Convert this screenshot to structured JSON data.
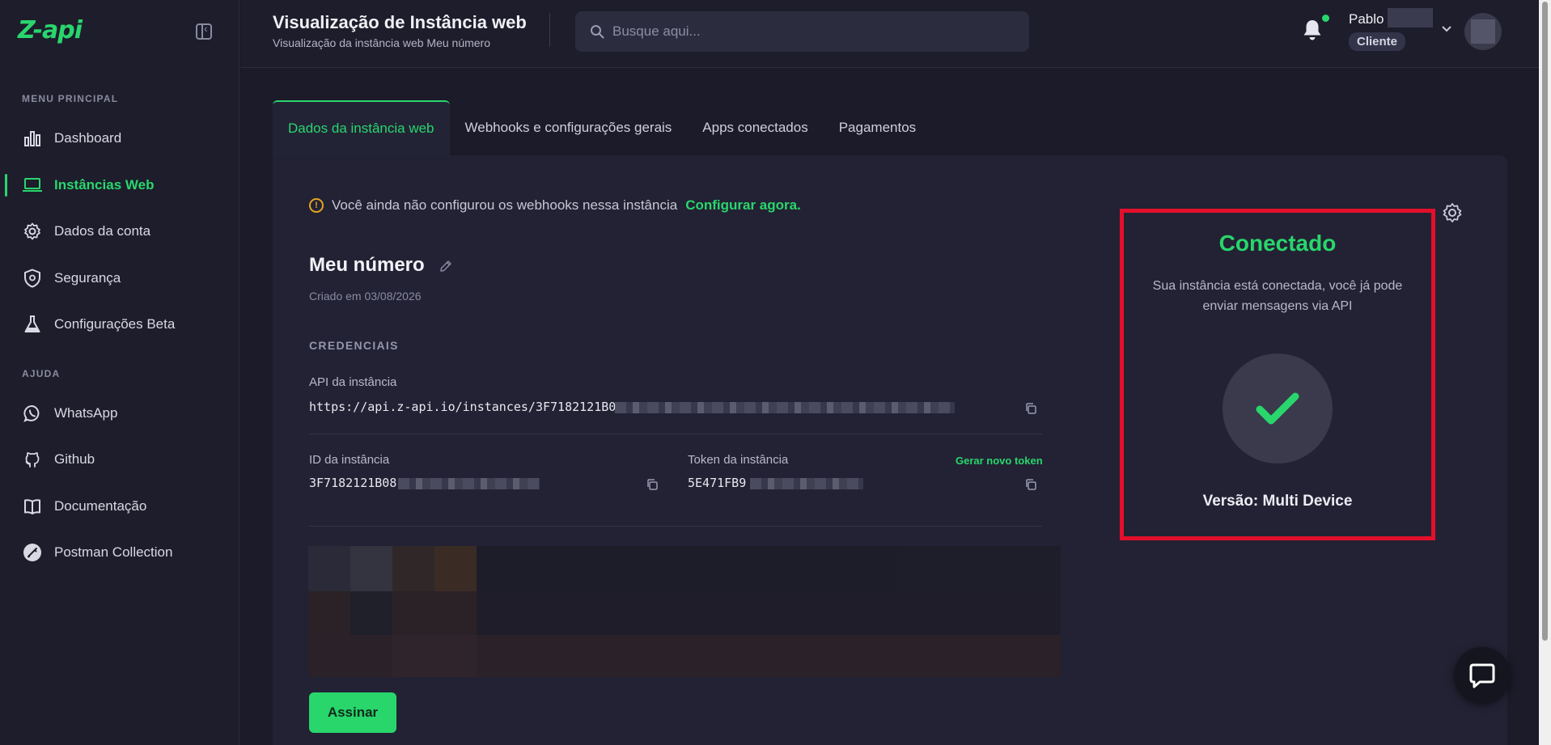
{
  "brand": {
    "logo_text": "Z-api"
  },
  "sidebar": {
    "main_section_title": "MENU PRINCIPAL",
    "help_section_title": "AJUDA",
    "main_items": [
      {
        "label": "Dashboard",
        "icon": "bar-chart-icon"
      },
      {
        "label": "Instâncias Web",
        "icon": "laptop-icon",
        "active": true
      },
      {
        "label": "Dados da conta",
        "icon": "gear-icon"
      },
      {
        "label": "Segurança",
        "icon": "shield-icon"
      },
      {
        "label": "Configurações Beta",
        "icon": "flask-icon"
      }
    ],
    "help_items": [
      {
        "label": "WhatsApp",
        "icon": "whatsapp-icon"
      },
      {
        "label": "Github",
        "icon": "github-icon"
      },
      {
        "label": "Documentação",
        "icon": "book-icon"
      },
      {
        "label": "Postman Collection",
        "icon": "postman-icon"
      }
    ]
  },
  "header": {
    "title": "Visualização de Instância web",
    "subtitle": "Visualização da instância web Meu número",
    "search_placeholder": "Busque aqui...",
    "user_name": "Pablo",
    "user_role": "Cliente"
  },
  "tabs": [
    {
      "label": "Dados da instância web",
      "active": true
    },
    {
      "label": "Webhooks e configurações gerais"
    },
    {
      "label": "Apps conectados"
    },
    {
      "label": "Pagamentos"
    }
  ],
  "instance": {
    "warning_text": "Você ainda não configurou os webhooks nessa instância",
    "warning_link": "Configurar agora.",
    "name": "Meu número",
    "created": "Criado em 03/08/2026",
    "credentials_title": "CREDENCIAIS",
    "api_label": "API da instância",
    "api_value": "https://api.z-api.io/instances/3F7182121B0",
    "id_label": "ID da instância",
    "id_value": "3F7182121B08",
    "token_label": "Token da instância",
    "token_value": "5E471FB9",
    "regen_token": "Gerar novo token",
    "sign_button": "Assinar"
  },
  "status": {
    "title": "Conectado",
    "description": "Sua instância está conectada, você já pode enviar mensagens via API",
    "version": "Versão: Multi Device"
  },
  "colors": {
    "accent": "#29d66c",
    "highlight_border": "#e30f2b",
    "background": "#1b1b29"
  }
}
